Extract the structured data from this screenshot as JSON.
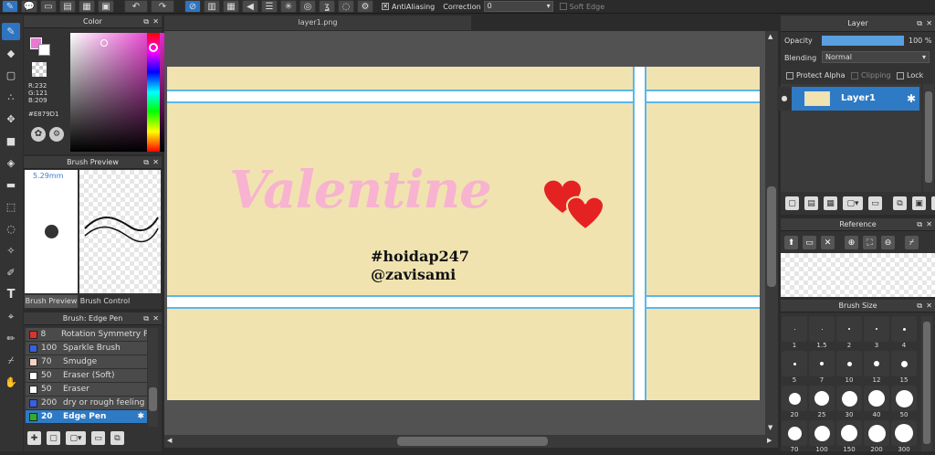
{
  "toolbar": {
    "antialiasing_label": "AntiAliasing",
    "correction_label": "Correction",
    "correction_value": "0",
    "soft_edge_label": "Soft Edge"
  },
  "document_tab": "layer1.png",
  "color_panel": {
    "title": "Color",
    "r": "R:232",
    "g": "G:121",
    "b": "B:209",
    "hex": "#E879D1",
    "primary_color": "#e879d1"
  },
  "brush_preview": {
    "title": "Brush Preview",
    "size": "5.29mm",
    "tabs": [
      "Brush Preview",
      "Brush Control"
    ]
  },
  "brush_list": {
    "title": "Brush: Edge Pen",
    "items": [
      {
        "size": "8",
        "name": "Rotation Symmetry Pe",
        "color": "#e03030"
      },
      {
        "size": "100",
        "name": "Sparkle Brush",
        "color": "#3a5fe0"
      },
      {
        "size": "70",
        "name": "Smudge",
        "color": "#f4d3c4"
      },
      {
        "size": "50",
        "name": "Eraser (Soft)",
        "color": "#ffffff"
      },
      {
        "size": "50",
        "name": "Eraser",
        "color": "#ffffff"
      },
      {
        "size": "200",
        "name": "dry or rough feeling",
        "color": "#3a5fe0"
      },
      {
        "size": "20",
        "name": "Edge Pen",
        "color": "#2bb02b"
      }
    ]
  },
  "canvas": {
    "headline": "Valentine",
    "line1": "#hoidap247",
    "line2": "@zavisami",
    "bg": "#f0e3b0",
    "text_color": "#f7b3cf",
    "heart_color": "#e52222"
  },
  "layer_panel": {
    "title": "Layer",
    "opacity_label": "Opacity",
    "opacity_value": "100 %",
    "opacity_fraction": 1.0,
    "blending_label": "Blending",
    "blending_value": "Normal",
    "protect_alpha": "Protect Alpha",
    "clipping": "Clipping",
    "lock": "Lock",
    "layer_name": "Layer1"
  },
  "reference_panel": {
    "title": "Reference"
  },
  "brush_size_panel": {
    "title": "Brush Size",
    "sizes": [
      "1",
      "1.5",
      "2",
      "3",
      "4",
      "5",
      "7",
      "10",
      "12",
      "15",
      "20",
      "25",
      "30",
      "40",
      "50",
      "70",
      "100",
      "150",
      "200",
      "300"
    ]
  }
}
